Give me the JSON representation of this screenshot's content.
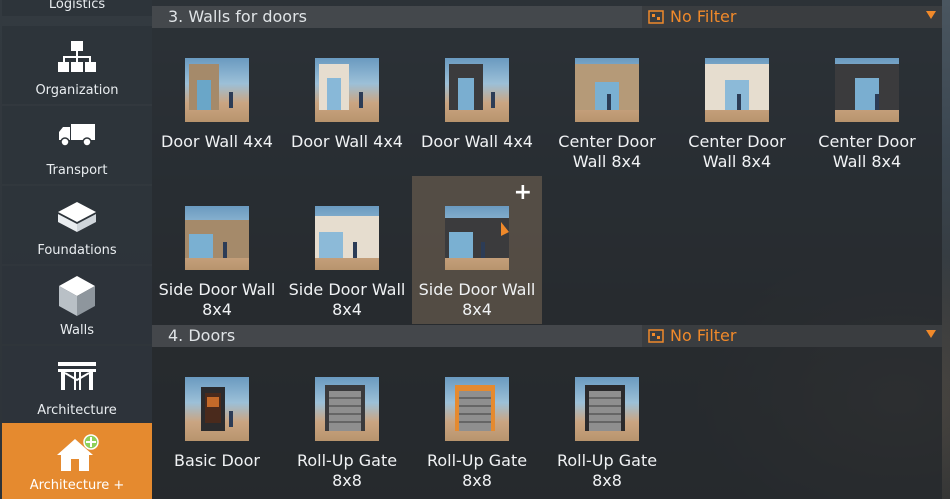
{
  "sidebar": {
    "top_partial": "Logistics",
    "items": [
      {
        "label": "Organization",
        "icon": "org-chart-icon"
      },
      {
        "label": "Transport",
        "icon": "truck-icon"
      },
      {
        "label": "Foundations",
        "icon": "foundation-icon"
      },
      {
        "label": "Walls",
        "icon": "walls-icon"
      },
      {
        "label": "Architecture",
        "icon": "architecture-icon"
      },
      {
        "label": "Architecture +",
        "icon": "house-plus-icon",
        "active": true
      }
    ]
  },
  "sections": [
    {
      "title": "3.  Walls for doors",
      "filter": "No Filter",
      "items": [
        {
          "label": "Door Wall 4x4"
        },
        {
          "label": "Door Wall 4x4"
        },
        {
          "label": "Door Wall 4x4"
        },
        {
          "label": "Center Door Wall 8x4"
        },
        {
          "label": "Center Door Wall 8x4"
        },
        {
          "label": "Center Door Wall 8x4"
        },
        {
          "label": "Side Door Wall 8x4"
        },
        {
          "label": "Side Door Wall 8x4"
        },
        {
          "label": "Side Door Wall 8x4",
          "selected": true
        }
      ]
    },
    {
      "title": "4.  Doors",
      "filter": "No Filter",
      "items": [
        {
          "label": "Basic Door"
        },
        {
          "label": "Roll-Up Gate 8x8"
        },
        {
          "label": "Roll-Up Gate 8x8"
        },
        {
          "label": "Roll-Up Gate 8x8"
        }
      ]
    }
  ],
  "colors": {
    "accent": "#e58a2f",
    "filter_text": "#f0892a"
  }
}
